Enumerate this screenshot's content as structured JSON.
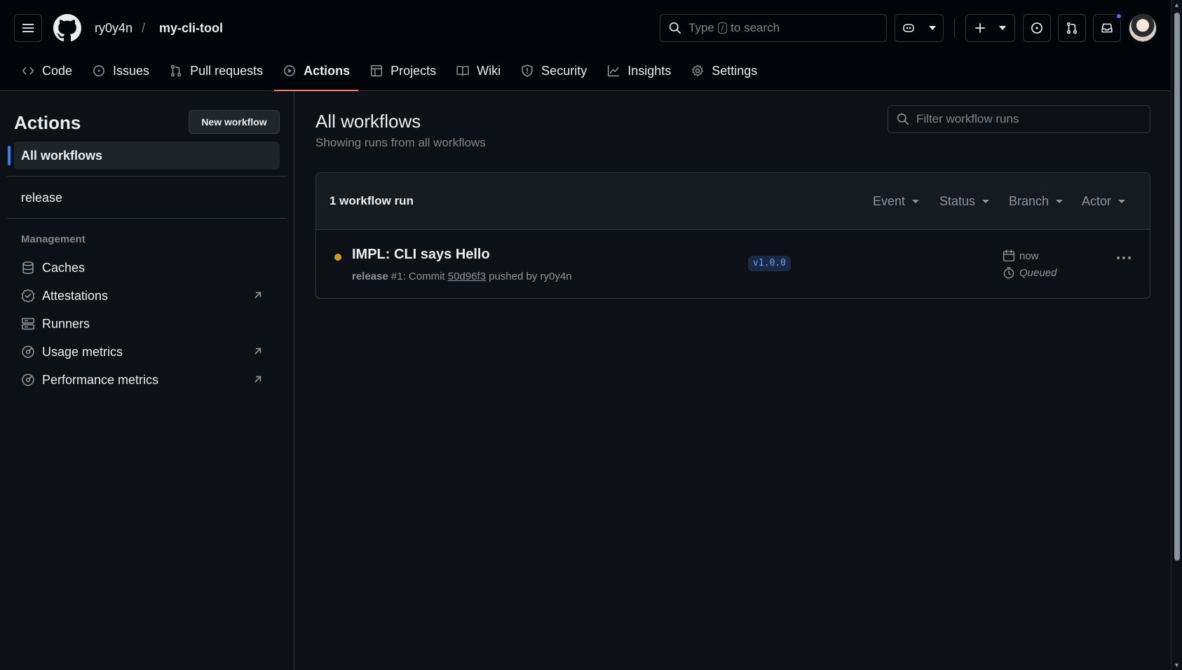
{
  "header": {
    "owner": "ry0y4n",
    "separator": "/",
    "repo": "my-cli-tool",
    "search": {
      "prefix": "Type",
      "key": "/",
      "suffix": "to search"
    },
    "notification_color": "#2f81f7"
  },
  "tabs": [
    {
      "label": "Code",
      "icon": "code-icon"
    },
    {
      "label": "Issues",
      "icon": "issue-icon"
    },
    {
      "label": "Pull requests",
      "icon": "pull-request-icon"
    },
    {
      "label": "Actions",
      "icon": "play-icon",
      "active": true
    },
    {
      "label": "Projects",
      "icon": "table-icon"
    },
    {
      "label": "Wiki",
      "icon": "book-icon"
    },
    {
      "label": "Security",
      "icon": "shield-icon"
    },
    {
      "label": "Insights",
      "icon": "graph-icon"
    },
    {
      "label": "Settings",
      "icon": "gear-icon"
    }
  ],
  "sidebar": {
    "title": "Actions",
    "new_workflow_label": "New workflow",
    "all_workflows_label": "All workflows",
    "workflows": [
      {
        "label": "release"
      }
    ],
    "management_heading": "Management",
    "management": [
      {
        "label": "Caches",
        "icon": "database-icon"
      },
      {
        "label": "Attestations",
        "icon": "verified-icon",
        "external": true
      },
      {
        "label": "Runners",
        "icon": "server-icon"
      },
      {
        "label": "Usage metrics",
        "icon": "meter-icon",
        "external": true
      },
      {
        "label": "Performance metrics",
        "icon": "meter-icon",
        "external": true
      }
    ]
  },
  "main": {
    "title": "All workflows",
    "subtitle": "Showing runs from all workflows",
    "filter_placeholder": "Filter workflow runs",
    "runs_count": "1 workflow run",
    "filters": [
      "Event",
      "Status",
      "Branch",
      "Actor"
    ],
    "runs": [
      {
        "title": "IMPL: CLI says Hello",
        "workflow": "release",
        "run_number": "#1: Commit",
        "commit": "50d96f3",
        "pushed_by": "pushed by ry0y4n",
        "branch": "v1.0.0",
        "time": "now",
        "status": "Queued",
        "status_color": "#d29922"
      }
    ]
  }
}
